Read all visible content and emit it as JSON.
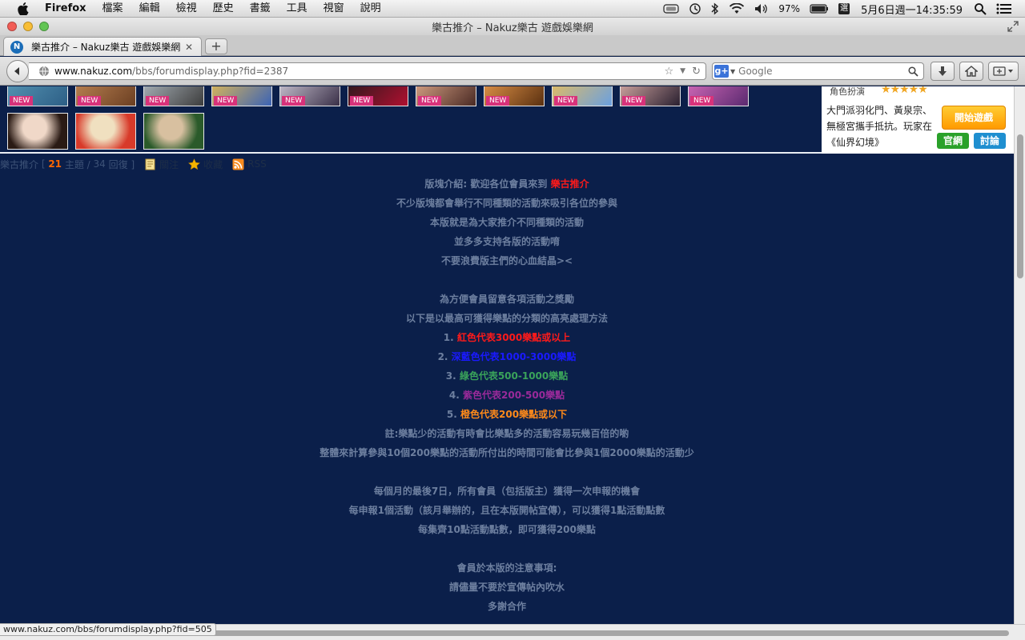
{
  "menubar": {
    "app_name": "Firefox",
    "items": [
      "檔案",
      "編輯",
      "檢視",
      "歷史",
      "書籤",
      "工具",
      "視窗",
      "說明"
    ],
    "battery": "97%",
    "ime": "選",
    "clock": "5月6日週一14:35:59"
  },
  "window": {
    "title": "樂古推介 – Nakuz樂古 遊戲娛樂網"
  },
  "tab": {
    "label": "樂古推介 – Nakuz樂古 遊戲娛樂網",
    "favicon": "N"
  },
  "navbar": {
    "url_host": "www.nakuz.com",
    "url_path": "/bbs/forumdisplay.php?fid=2387",
    "search_placeholder": "Google",
    "engine_icon": "g+"
  },
  "banner": {
    "badge": "NEW",
    "thumb_colors": [
      [
        "#5a9ab8",
        "#2d5f86"
      ],
      [
        "#c48a58",
        "#6b3f22"
      ],
      [
        "#b6c0c8",
        "#3d3d3d"
      ],
      [
        "#f2c24a",
        "#3b63b5"
      ],
      [
        "#d9d3e0",
        "#3a3048"
      ],
      [
        "#1a1a1a",
        "#b01030"
      ],
      [
        "#e8b090",
        "#4a2a24"
      ],
      [
        "#f2a050",
        "#5a3010"
      ],
      [
        "#f4c050",
        "#6aa0e0"
      ],
      [
        "#e8b8b0",
        "#2a2030"
      ],
      [
        "#e070c0",
        "#5a2a70"
      ]
    ],
    "plain_thumb_colors": [
      [
        "#f0d8c8",
        "#2a1a14"
      ],
      [
        "#f0e0c0",
        "#d83a2a"
      ],
      [
        "#d8c0a0",
        "#2a5a2a"
      ]
    ]
  },
  "ad": {
    "role_label": "角色扮演",
    "stars": "★★★★★",
    "text": "大門派羽化門、黃泉宗、無極宮攜手抵抗。玩家在《仙界幻境》",
    "start_button": "開始遊戲",
    "site_button": "官網",
    "discuss_button": "討論",
    "colors": {
      "site": "#2aa12a",
      "discuss": "#1f8fd0"
    }
  },
  "forum_header": {
    "name": "樂古推介",
    "open_bracket": " [ ",
    "topics": "21",
    "topics_label": " 主題 / ",
    "replies": "34",
    "replies_label": " 回復 ]",
    "follow_label": "關注",
    "favorite_label": "收藏",
    "rss_label": "RSS"
  },
  "intro": {
    "line1_prefix": "版塊介紹: 歡迎各位會員來到 ",
    "line1_highlight": "樂古推介",
    "line2": "不少版塊都會舉行不同種類的活動來吸引各位的參與",
    "line3": "本版就是為大家推介不同種類的活動",
    "line4": "並多多支持各版的活動唷",
    "line5": "不要浪費版主們的心血結晶><",
    "line6": "為方便會員留意各項活動之獎勵",
    "line7": "以下是以最高可獲得樂點的分類的高亮處理方法",
    "levels": [
      {
        "num": "1. ",
        "text": "紅色代表3000樂點或以上",
        "color": "#ff1a1a"
      },
      {
        "num": "2. ",
        "text": "深藍色代表1000-3000樂點",
        "color": "#1a1aff"
      },
      {
        "num": "3. ",
        "text": "綠色代表500-1000樂點",
        "color": "#3aa35a"
      },
      {
        "num": "4. ",
        "text": "紫色代表200-500樂點",
        "color": "#9a2a9a"
      },
      {
        "num": "5. ",
        "text": "橙色代表200樂點或以下",
        "color": "#ff8a1a"
      }
    ],
    "line8": "註:樂點少的活動有時會比樂點多的活動容易玩幾百倍的喲",
    "line9": "整體來計算參與10個200樂點的活動所付出的時間可能會比參與1個2000樂點的活動少",
    "line10": "每個月的最後7日，所有會員（包括版主）獲得一次申報的機會",
    "line11": "每申報1個活動（該月舉辦的，且在本版開帖宣傳），可以獲得1點活動點數",
    "line12": "每集齊10點活動點數，即可獲得200樂點",
    "line13": "會員於本版的注意事項:",
    "line14": "請儘量不要於宣傳帖內吹水",
    "line15": "多謝合作",
    "highlight_color": "#ff1a1a"
  },
  "status": {
    "link": "www.nakuz.com/bbs/forumdisplay.php?fid=505"
  }
}
